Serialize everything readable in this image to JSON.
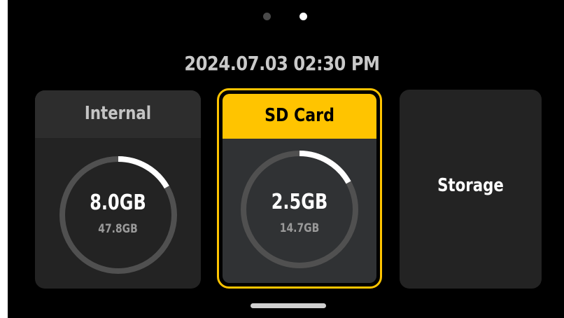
{
  "pager": {
    "active_index": 1,
    "count": 2
  },
  "datetime": "2024.07.03 02:30 PM",
  "cards": {
    "internal": {
      "title": "Internal",
      "used": "8.0GB",
      "total": "47.8GB",
      "used_fraction": 0.167
    },
    "sd_card": {
      "title": "SD Card",
      "used": "2.5GB",
      "total": "14.7GB",
      "used_fraction": 0.17,
      "selected": true
    },
    "storage": {
      "title": "Storage"
    }
  },
  "colors": {
    "accent": "#ffc400",
    "ring_track": "#505050",
    "ring_progress": "#ffffff"
  }
}
